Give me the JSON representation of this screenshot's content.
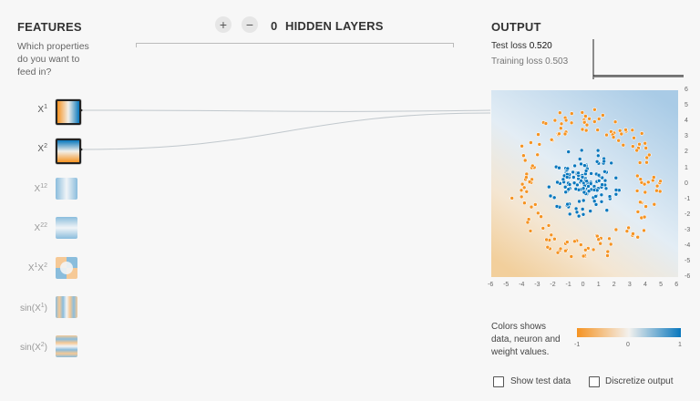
{
  "features_panel": {
    "title": "FEATURES",
    "question_lines": [
      "Which properties",
      "do you want to",
      "feed in?"
    ],
    "items": [
      {
        "base": "X",
        "sup": "1",
        "tail": "",
        "active": true
      },
      {
        "base": "X",
        "sup": "2",
        "tail": "",
        "active": true
      },
      {
        "base": "X",
        "sup": "12",
        "tail": "",
        "active": false
      },
      {
        "base": "X",
        "sup": "22",
        "tail": "",
        "active": false
      },
      {
        "base": "X",
        "sup": "1",
        "mid": "X",
        "sup2": "2",
        "active": false
      },
      {
        "base": "sin(X",
        "sup": "1",
        "tail": ")",
        "active": false
      },
      {
        "base": "sin(X",
        "sup": "2",
        "tail": ")",
        "active": false
      }
    ]
  },
  "hidden_layers": {
    "add_label": "+",
    "remove_label": "−",
    "count": "0",
    "label": "HIDDEN LAYERS"
  },
  "output_panel": {
    "title": "OUTPUT",
    "test_loss_label": "Test loss",
    "test_loss_value": "0.520",
    "training_loss_label": "Training loss",
    "training_loss_value": "0.503",
    "y_ticks": [
      "6",
      "5",
      "4",
      "3",
      "2",
      "1",
      "0",
      "-1",
      "-2",
      "-3",
      "-4",
      "-5",
      "-6"
    ],
    "x_ticks": [
      "-6",
      "-5",
      "-4",
      "-3",
      "-2",
      "-1",
      "0",
      "1",
      "2",
      "3",
      "4",
      "5",
      "6"
    ],
    "colors_text_lines": [
      "Colors shows",
      "data, neuron and",
      "weight values."
    ],
    "scale_labels": [
      "-1",
      "0",
      "1"
    ],
    "show_test_data_label": "Show test data",
    "discretize_output_label": "Discretize output"
  },
  "colors": {
    "orange": "#f59322",
    "blue": "#0877bd",
    "light_blue": "#bcd8ec",
    "light_orange": "#f5d6ad"
  }
}
